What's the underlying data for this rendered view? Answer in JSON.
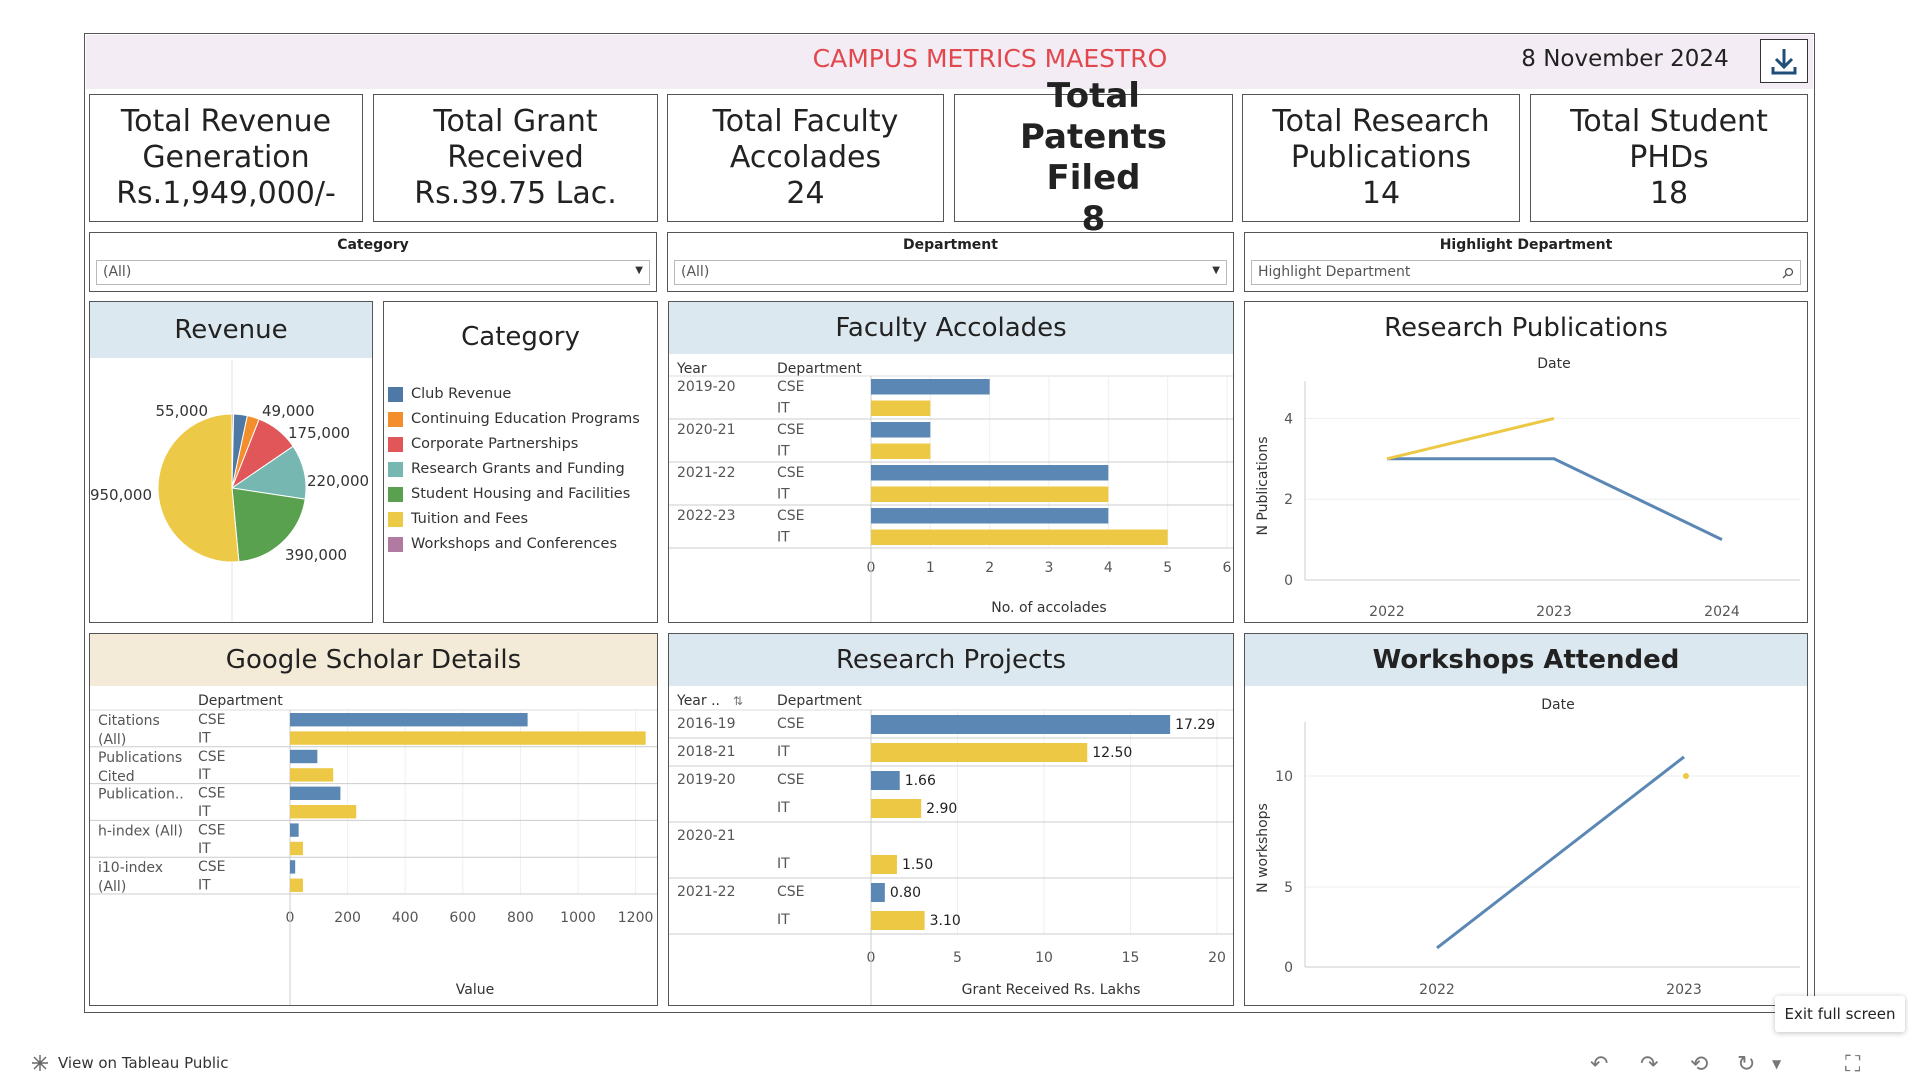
{
  "header": {
    "title": "CAMPUS METRICS MAESTRO",
    "date": "8 November 2024"
  },
  "kpis": [
    {
      "label": "Total Revenue Generation",
      "value": "Rs.1,949,000/-"
    },
    {
      "label": "Total Grant Received",
      "value": "Rs.39.75 Lac."
    },
    {
      "label": "Total Faculty Accolades",
      "value": "24"
    },
    {
      "label": "Total Patents Filed",
      "value": "8"
    },
    {
      "label": "Total Research Publications",
      "value": "14"
    },
    {
      "label": "Total Student PHDs",
      "value": "18"
    }
  ],
  "filters": {
    "category": {
      "label": "Category",
      "value": "(All)"
    },
    "department": {
      "label": "Department",
      "value": "(All)"
    },
    "highlight": {
      "label": "Highlight Department",
      "placeholder": "Highlight Department"
    }
  },
  "colors": {
    "title_red": "#e0484e",
    "cse_blue": "#5b87b5",
    "it_yellow": "#ecc845",
    "header_blue": "#dce8ef",
    "header_beige": "#f3ebd7",
    "banner": "#f4ecf4"
  },
  "revenue": {
    "title": "Revenue",
    "slice_labels": [
      "55,000",
      "49,000",
      "175,000",
      "220,000",
      "390,000",
      "950,000"
    ]
  },
  "category_legend": {
    "title": "Category",
    "items": [
      {
        "name": "Club Revenue",
        "color": "#4e79a7"
      },
      {
        "name": "Continuing Education Programs",
        "color": "#f28e2b"
      },
      {
        "name": "Corporate Partnerships",
        "color": "#e15759"
      },
      {
        "name": "Research Grants and Funding",
        "color": "#76b7b2"
      },
      {
        "name": "Student Housing and Facilities",
        "color": "#59a14f"
      },
      {
        "name": "Tuition and Fees",
        "color": "#edc948"
      },
      {
        "name": "Workshops and Conferences",
        "color": "#b07aa1"
      }
    ]
  },
  "faculty": {
    "title": "Faculty Accolades",
    "col_year": "Year",
    "col_dept": "Department",
    "xlabel": "No. of accolades",
    "ticks": [
      "0",
      "1",
      "2",
      "3",
      "4",
      "5",
      "6"
    ]
  },
  "research_pubs": {
    "title": "Research Publications",
    "date_label": "Date",
    "ylabel": "N Publications",
    "xticks": [
      "2022",
      "2023",
      "2024"
    ],
    "yticks": [
      "0",
      "2",
      "4"
    ]
  },
  "scholar": {
    "title": "Google Scholar Details",
    "col_dept": "Department",
    "xlabel": "Value",
    "ticks": [
      "0",
      "200",
      "400",
      "600",
      "800",
      "1000",
      "1200"
    ],
    "groups": [
      {
        "l1": "Citations",
        "l2": "(All)"
      },
      {
        "l1": "Publications",
        "l2": "Cited"
      },
      {
        "l1": "Publication..",
        "l2": ""
      },
      {
        "l1": "h-index (All)",
        "l2": ""
      },
      {
        "l1": "i10-index",
        "l2": "(All)"
      }
    ]
  },
  "projects": {
    "title": "Research Projects",
    "col_year": "Year ..",
    "col_dept": "Department",
    "xlabel": "Grant Received Rs. Lakhs",
    "ticks": [
      "0",
      "5",
      "10",
      "15",
      "20"
    ]
  },
  "workshops": {
    "title": "Workshops Attended",
    "date_label": "Date",
    "ylabel": "N workshops",
    "xticks": [
      "2022",
      "2023"
    ],
    "yticks": [
      "0",
      "5",
      "10"
    ]
  },
  "footer": {
    "tableau_link": "View on Tableau Public",
    "exit_label": "Exit full screen"
  },
  "chart_data": [
    {
      "type": "pie",
      "title": "Revenue",
      "categories": [
        "Club Revenue",
        "Continuing Education Programs",
        "Corporate Partnerships",
        "Research Grants and Funding",
        "Student Housing and Facilities",
        "Tuition and Fees",
        "Workshops and Conferences"
      ],
      "values": [
        55000,
        49000,
        175000,
        220000,
        390000,
        950000,
        0
      ],
      "labels": [
        "55,000",
        "49,000",
        "175,000",
        "220,000",
        "390,000",
        "950,000",
        ""
      ]
    },
    {
      "type": "bar",
      "title": "Faculty Accolades",
      "xlabel": "No. of accolades",
      "rows": [
        {
          "year": "2019-20",
          "dept": "CSE",
          "value": 2
        },
        {
          "year": "",
          "dept": "IT",
          "value": 1
        },
        {
          "year": "2020-21",
          "dept": "CSE",
          "value": 1
        },
        {
          "year": "",
          "dept": "IT",
          "value": 1
        },
        {
          "year": "2021-22",
          "dept": "CSE",
          "value": 4
        },
        {
          "year": "",
          "dept": "IT",
          "value": 4
        },
        {
          "year": "2022-23",
          "dept": "CSE",
          "value": 4
        },
        {
          "year": "",
          "dept": "IT",
          "value": 5
        }
      ],
      "xlim": [
        0,
        6
      ]
    },
    {
      "type": "line",
      "title": "Research Publications",
      "ylabel": "N Publications",
      "x": [
        "2022",
        "2023",
        "2024"
      ],
      "series": [
        {
          "name": "CSE",
          "values": [
            3,
            3,
            1
          ]
        },
        {
          "name": "IT",
          "values": [
            3,
            4,
            null
          ]
        }
      ],
      "ylim": [
        0,
        5
      ]
    },
    {
      "type": "bar",
      "title": "Google Scholar Details",
      "xlabel": "Value",
      "rows": [
        {
          "group": 0,
          "dept": "CSE",
          "value": 825
        },
        {
          "group": 0,
          "dept": "IT",
          "value": 1235
        },
        {
          "group": 1,
          "dept": "CSE",
          "value": 95
        },
        {
          "group": 1,
          "dept": "IT",
          "value": 150
        },
        {
          "group": 2,
          "dept": "CSE",
          "value": 175
        },
        {
          "group": 2,
          "dept": "IT",
          "value": 230
        },
        {
          "group": 3,
          "dept": "CSE",
          "value": 30
        },
        {
          "group": 3,
          "dept": "IT",
          "value": 45
        },
        {
          "group": 4,
          "dept": "CSE",
          "value": 18
        },
        {
          "group": 4,
          "dept": "IT",
          "value": 45
        }
      ],
      "xlim": [
        0,
        1250
      ]
    },
    {
      "type": "bar",
      "title": "Research Projects",
      "xlabel": "Grant Received Rs. Lakhs",
      "rows": [
        {
          "year": "2016-19",
          "dept": "CSE",
          "value": 17.29,
          "label": "17.29"
        },
        {
          "year": "2018-21",
          "dept": "IT",
          "value": 12.5,
          "label": "12.50"
        },
        {
          "year": "2019-20",
          "dept": "CSE",
          "value": 1.66,
          "label": "1.66"
        },
        {
          "year": "",
          "dept": "IT",
          "value": 2.9,
          "label": "2.90"
        },
        {
          "year": "2020-21",
          "dept": "",
          "value": null,
          "label": ""
        },
        {
          "year": "",
          "dept": "IT",
          "value": 1.5,
          "label": "1.50"
        },
        {
          "year": "2021-22",
          "dept": "CSE",
          "value": 0.8,
          "label": "0.80"
        },
        {
          "year": "",
          "dept": "IT",
          "value": 3.1,
          "label": "3.10"
        }
      ],
      "xlim": [
        0,
        20
      ]
    },
    {
      "type": "line",
      "title": "Workshops Attended",
      "ylabel": "N workshops",
      "x": [
        "2022",
        "2023"
      ],
      "series": [
        {
          "name": "CSE",
          "values": [
            1,
            11
          ]
        },
        {
          "name": "IT",
          "values": [
            null,
            10
          ]
        }
      ],
      "ylim": [
        0,
        11
      ]
    }
  ]
}
